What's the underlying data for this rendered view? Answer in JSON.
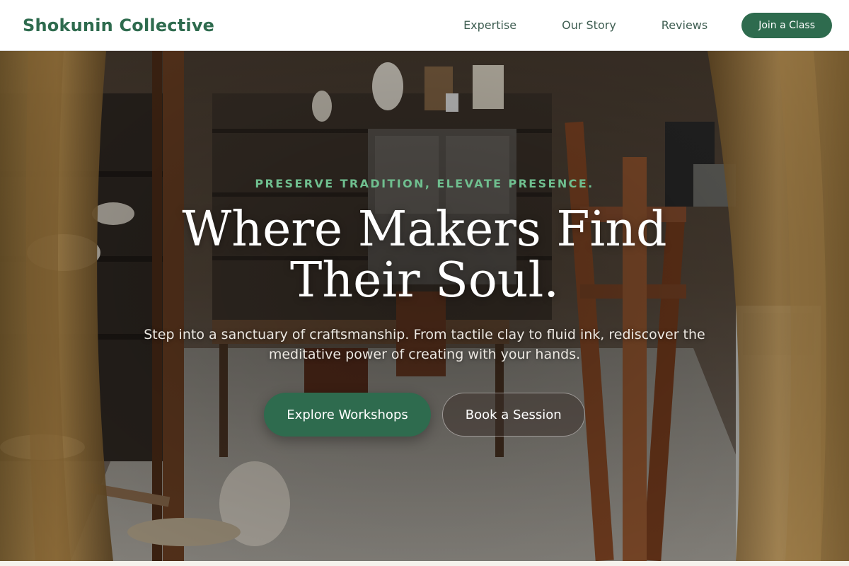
{
  "header": {
    "brand": "Shokunin Collective",
    "nav": [
      {
        "label": "Expertise"
      },
      {
        "label": "Our Story"
      },
      {
        "label": "Reviews"
      }
    ],
    "cta_label": "Join a Class"
  },
  "hero": {
    "eyebrow": "PRESERVE TRADITION, ELEVATE PRESENCE.",
    "headline": "Where Makers Find Their Soul.",
    "subtext": "Step into a sanctuary of craftsmanship. From tactile clay to fluid ink, rediscover the meditative power of creating with your hands.",
    "primary_button": "Explore Workshops",
    "secondary_button": "Book a Session"
  },
  "colors": {
    "brand_green": "#2e6b4e",
    "eyebrow_green": "#6fbf8f",
    "header_bg": "#ffffff",
    "nav_text": "#3f5e52"
  }
}
